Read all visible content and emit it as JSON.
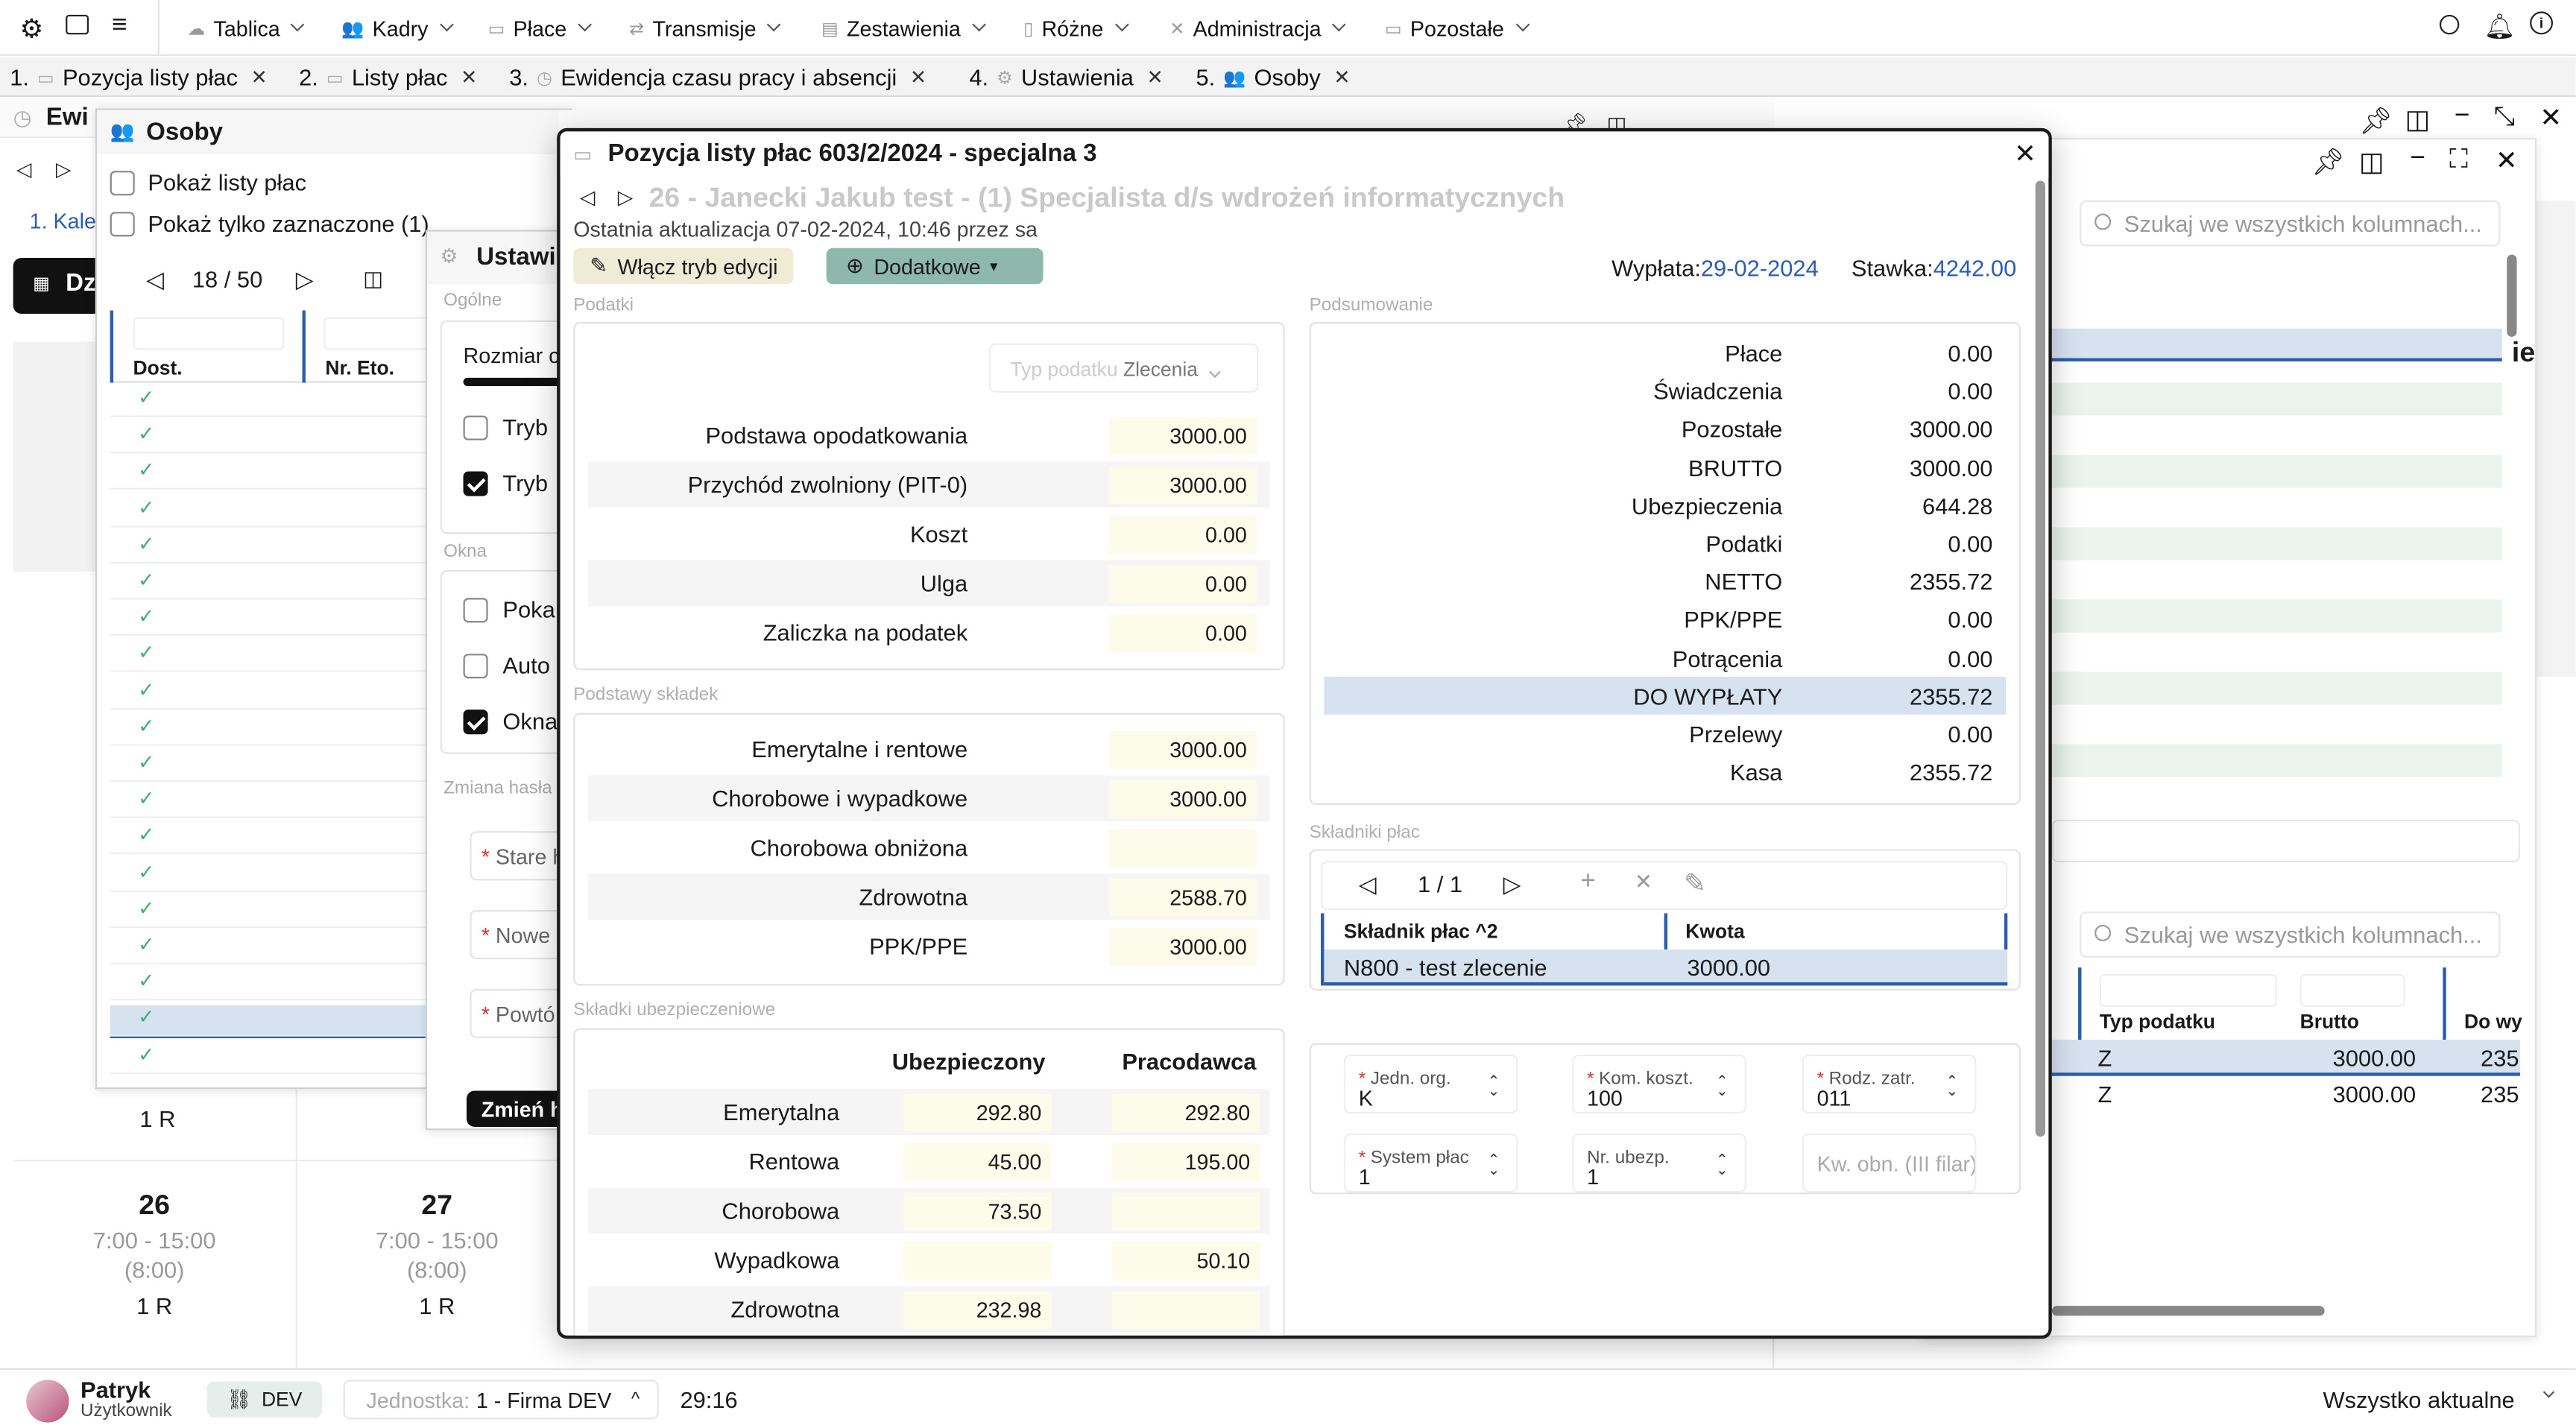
{
  "topmenu": {
    "items": [
      {
        "label": "Tablica",
        "icon": "dashboard-icon"
      },
      {
        "label": "Kadry",
        "icon": "people-icon"
      },
      {
        "label": "Płace",
        "icon": "wallet-icon"
      },
      {
        "label": "Transmisje",
        "icon": "transmit-icon"
      },
      {
        "label": "Zestawienia",
        "icon": "report-icon"
      },
      {
        "label": "Różne",
        "icon": "document-icon"
      },
      {
        "label": "Administracja",
        "icon": "tools-icon"
      },
      {
        "label": "Pozostałe",
        "icon": "folder-icon"
      }
    ]
  },
  "tabs": [
    {
      "num": "1.",
      "label": "Pozycja listy płac"
    },
    {
      "num": "2.",
      "label": "Listy płac"
    },
    {
      "num": "3.",
      "label": "Ewidencja czasu pracy i absencji"
    },
    {
      "num": "4.",
      "label": "Ustawienia"
    },
    {
      "num": "5.",
      "label": "Osoby"
    }
  ],
  "ewidencja": {
    "title": "Ewi",
    "kalendarz": "1. Kale",
    "dz": "Dz",
    "days": [
      {
        "num": "26",
        "hours": "7:00 - 15:00",
        "total": "(8:00)",
        "code": "1 R"
      },
      {
        "num": "27",
        "hours": "7:00 - 15:00",
        "total": "(8:00)",
        "code": "1 R"
      }
    ],
    "top_codes": [
      "1 R",
      "1"
    ]
  },
  "osoby": {
    "title": "Osoby",
    "show_lists": "Pokaż listy płac",
    "show_selected": "Pokaż tylko zaznaczone (1)",
    "pager": "18 / 50",
    "col1": "Dost.",
    "col2": "Nr. Eto."
  },
  "ustawienia": {
    "title": "Ustawi",
    "ogolne": "Ogólne",
    "rozmiar": "Rozmiar c",
    "tryb1": "Tryb",
    "tryb2": "Tryb",
    "okna": "Okna",
    "poka": "Poka",
    "auto": "Auto",
    "okna2": "Okna",
    "zmiana_hasla": "Zmiana hasła",
    "stare": "Stare h",
    "nowe": "Nowe",
    "powtorz": "Powtó",
    "zmien": "Zmień h"
  },
  "dialog": {
    "title": "Pozycja listy płac 603/2/2024 - specjalna 3",
    "person": "26 - Janecki Jakub test - (1) Specjalista d/s wdrożeń informatycznych",
    "updated": "Ostatnia aktualizacja 07-02-2024, 10:46 przez sa",
    "edit_button": "Włącz tryb edycji",
    "extra_button": "Dodatkowe",
    "wyplata_label": "Wypłata:",
    "wyplata_value": "29-02-2024",
    "stawka_label": "Stawka:",
    "stawka_value": "4242.00",
    "podatki": {
      "section": "Podatki",
      "typ_label": "Typ podatku",
      "typ_value": "Zlecenia",
      "rows": [
        {
          "label": "Podstawa opodatkowania",
          "value": "3000.00"
        },
        {
          "label": "Przychód zwolniony (PIT-0)",
          "value": "3000.00"
        },
        {
          "label": "Koszt",
          "value": "0.00"
        },
        {
          "label": "Ulga",
          "value": "0.00"
        },
        {
          "label": "Zaliczka na podatek",
          "value": "0.00"
        }
      ]
    },
    "podstawy": {
      "section": "Podstawy składek",
      "rows": [
        {
          "label": "Emerytalne i rentowe",
          "value": "3000.00"
        },
        {
          "label": "Chorobowe i wypadkowe",
          "value": "3000.00"
        },
        {
          "label": "Chorobowa obniżona",
          "value": ""
        },
        {
          "label": "Zdrowotna",
          "value": "2588.70"
        },
        {
          "label": "PPK/PPE",
          "value": "3000.00"
        }
      ]
    },
    "skladki": {
      "section": "Składki ubezpieczeniowe",
      "col1": "Ubezpieczony",
      "col2": "Pracodawca",
      "rows": [
        {
          "label": "Emerytalna",
          "u": "292.80",
          "p": "292.80"
        },
        {
          "label": "Rentowa",
          "u": "45.00",
          "p": "195.00"
        },
        {
          "label": "Chorobowa",
          "u": "73.50",
          "p": ""
        },
        {
          "label": "Wypadkowa",
          "u": "",
          "p": "50.10"
        },
        {
          "label": "Zdrowotna",
          "u": "232.98",
          "p": ""
        }
      ]
    },
    "podsumowanie": {
      "section": "Podsumowanie",
      "rows": [
        {
          "label": "Płace",
          "value": "0.00"
        },
        {
          "label": "Świadczenia",
          "value": "0.00"
        },
        {
          "label": "Pozostałe",
          "value": "3000.00"
        },
        {
          "label": "BRUTTO",
          "value": "3000.00"
        },
        {
          "label": "Ubezpieczenia",
          "value": "644.28"
        },
        {
          "label": "Podatki",
          "value": "0.00"
        },
        {
          "label": "NETTO",
          "value": "2355.72"
        },
        {
          "label": "PPK/PPE",
          "value": "0.00"
        },
        {
          "label": "Potrącenia",
          "value": "0.00"
        },
        {
          "label": "DO WYPŁATY",
          "value": "2355.72"
        },
        {
          "label": "Przelewy",
          "value": "0.00"
        },
        {
          "label": "Kasa",
          "value": "2355.72"
        }
      ]
    },
    "skladniki": {
      "section": "Składniki płac",
      "pager": "1 / 1",
      "col1": "Składnik płac",
      "col1_sort": "2",
      "col2": "Kwota",
      "rows": [
        {
          "name": "N800 - test zlecenie",
          "amount": "3000.00"
        }
      ]
    },
    "fields": {
      "jedn_label": "Jedn. org.",
      "jedn_value": "K",
      "kom_label": "Kom. koszt.",
      "kom_value": "100",
      "rodz_label": "Rodz. zatr.",
      "rodz_value": "011",
      "sys_label": "System płac",
      "sys_value": "1",
      "nr_label": "Nr. ubezp.",
      "nr_value": "1",
      "kw_placeholder": "Kw. obn. (III filar)"
    }
  },
  "right_window": {
    "search_placeholder": "Szukaj we wszystkich kolumnach...",
    "search2_placeholder": "Szukaj we wszystkich kolumnach...",
    "partial_heading": "ie",
    "cols": [
      "Typ podatku",
      "Brutto",
      "Do wy"
    ],
    "rows": [
      {
        "typ": "Z",
        "brutto": "3000.00",
        "do": "235"
      },
      {
        "typ": "Z",
        "brutto": "3000.00",
        "do": "235"
      }
    ]
  },
  "statusbar": {
    "user_name": "Patryk",
    "user_role": "Użytkownik",
    "env": "DEV",
    "unit_label": "Jednostka:",
    "unit_value": "1 - Firma DEV",
    "timer": "29:16",
    "status": "Wszystko aktualne"
  },
  "colors": {
    "accent_blue": "#2a5db0",
    "highlight": "#d7e2f1",
    "input_bg": "#fdfbea",
    "check_green": "#3cae6f",
    "extra_btn": "#8fb8ad"
  }
}
